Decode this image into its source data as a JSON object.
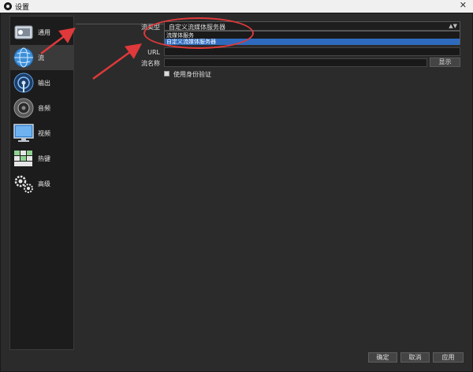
{
  "window": {
    "title": "设置",
    "close_glyph": "✕"
  },
  "sidebar": {
    "items": [
      {
        "label": "通用",
        "icon": "gear-panel-icon"
      },
      {
        "label": "流",
        "icon": "globe-icon"
      },
      {
        "label": "输出",
        "icon": "broadcast-icon"
      },
      {
        "label": "音频",
        "icon": "speaker-icon"
      },
      {
        "label": "视频",
        "icon": "monitor-icon"
      },
      {
        "label": "热键",
        "icon": "keyboard-icon"
      },
      {
        "label": "高级",
        "icon": "gears-icon"
      }
    ],
    "active_index": 1
  },
  "stream": {
    "type_label": "流类型",
    "type_value": "自定义流媒体服务器",
    "dropdown_options": [
      "流媒体服务",
      "自定义流媒体服务器"
    ],
    "dropdown_selected": 1,
    "url_label": "URL",
    "key_label": "流名称",
    "show_button": "显示",
    "auth_checkbox": "使用身份验证"
  },
  "footer": {
    "ok": "确定",
    "cancel": "取消",
    "apply": "应用"
  },
  "colors": {
    "annotation": "#e0393b",
    "selection": "#2e6bbf"
  }
}
